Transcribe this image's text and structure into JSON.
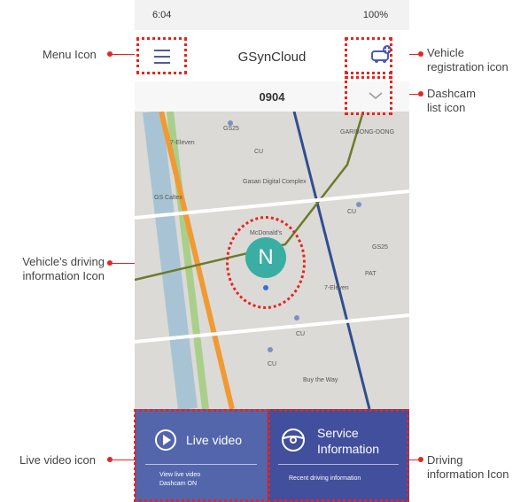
{
  "annotations": {
    "menu": "Menu Icon",
    "vehicle_reg_1": "Vehicle",
    "vehicle_reg_2": "registration icon",
    "dashcam_list_1": "Dashcam",
    "dashcam_list_2": "list icon",
    "driving_info_1": "Vehicle's driving",
    "driving_info_2": "information Icon",
    "live_video": "Live video icon",
    "driving_icon_1": "Driving",
    "driving_icon_2": "information Icon"
  },
  "status_bar": {
    "time": "6:04",
    "right": "100%"
  },
  "app": {
    "title": "GSynCloud"
  },
  "dashcam": {
    "name": "0904"
  },
  "map": {
    "marker_letter": "N",
    "labels": [
      "GS25",
      "CU",
      "7-Eleven",
      "GS Caltex",
      "Gasan Digital Complex",
      "McDonald's",
      "GARIBONG-DONG",
      "CU",
      "GS25",
      "PAT",
      "7-Eleven",
      "CU",
      "CU",
      "Buy the Way"
    ]
  },
  "cards": {
    "live_video": {
      "title": "Live video",
      "sub1": "View live video",
      "sub2": "Dashcam ON"
    },
    "service": {
      "title1": "Service",
      "title2": "Information",
      "sub": "Recent driving information"
    }
  },
  "colors": {
    "accent": "#e52521",
    "brand": "#4d5aa8",
    "marker": "#3aaea3"
  }
}
